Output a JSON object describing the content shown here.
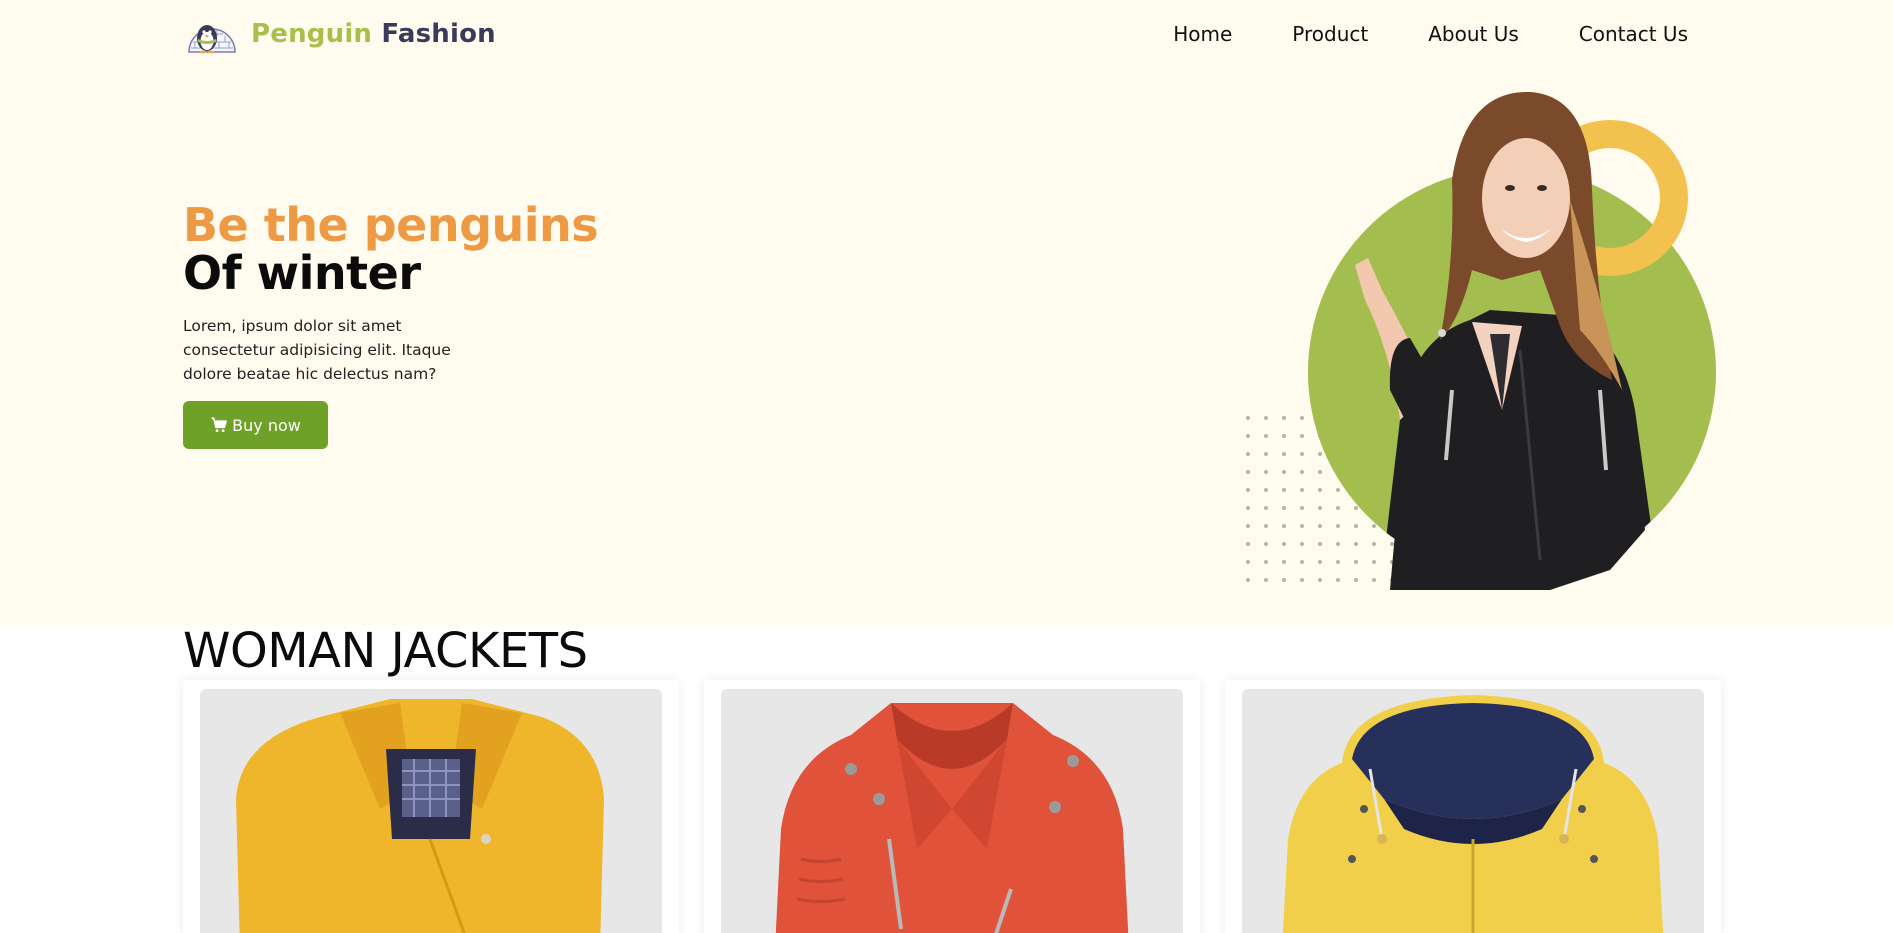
{
  "brand": {
    "word1": "Penguin",
    "word2": "Fashion",
    "logo_icon": "penguin-igloo-icon"
  },
  "nav": {
    "items": [
      {
        "label": "Home"
      },
      {
        "label": "Product"
      },
      {
        "label": "About Us"
      },
      {
        "label": "Contact Us"
      }
    ]
  },
  "hero": {
    "title_line1": "Be the penguins",
    "title_line2": "Of winter",
    "description": "Lorem, ipsum dolor sit amet consectetur adipisicing elit. Itaque dolore beatae hic delectus nam?",
    "button_label": "Buy now",
    "button_icon": "cart-icon",
    "image": "woman-leather-jacket-image"
  },
  "colors": {
    "background": "#fffbee",
    "accent_green": "#6fa028",
    "brand_green": "#a8c04b",
    "accent_orange": "#ee9a45",
    "ring_yellow": "#f2c14e",
    "circle_green": "#a4bd4f"
  },
  "products": {
    "section_title": "WOMAN JACKETS",
    "items": [
      {
        "image": "yellow-wool-coat-image",
        "color": "#f0b62b"
      },
      {
        "image": "red-leather-jacket-image",
        "color": "#e0533a"
      },
      {
        "image": "yellow-rain-jacket-image",
        "color": "#f2cf4a"
      }
    ]
  }
}
